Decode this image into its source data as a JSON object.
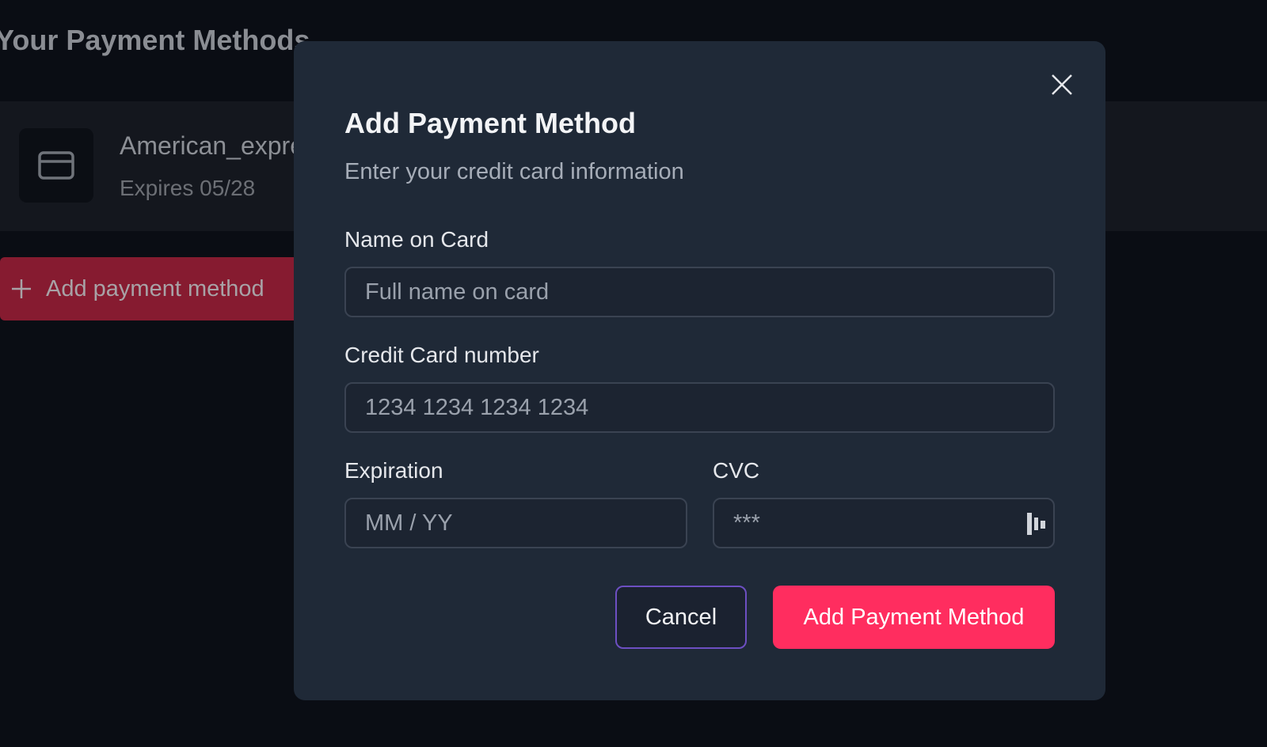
{
  "page": {
    "title": "Your Payment Methods",
    "saved_card": {
      "icon": "credit-card-icon",
      "name": "American_express",
      "expires": "Expires 05/28"
    },
    "add_button": {
      "icon": "plus-icon",
      "label": "Add payment method"
    }
  },
  "modal": {
    "title": "Add Payment Method",
    "subtitle": "Enter your credit card information",
    "close_icon": "close-icon",
    "fields": {
      "name": {
        "label": "Name on Card",
        "placeholder": "Full name on card",
        "value": ""
      },
      "number": {
        "label": "Credit Card number",
        "placeholder": "1234 1234 1234 1234",
        "value": ""
      },
      "expiration": {
        "label": "Expiration",
        "placeholder": "MM / YY",
        "value": ""
      },
      "cvc": {
        "label": "CVC",
        "placeholder": "***",
        "value": "",
        "icon": "card-back-icon"
      }
    },
    "actions": {
      "cancel_label": "Cancel",
      "submit_label": "Add Payment Method"
    }
  },
  "colors": {
    "background": "#0a0d14",
    "modal": "#1f2937",
    "accent": "#ff2d5f",
    "cancel_border": "#6d4fc2",
    "bg_add_button": "#861b30"
  }
}
